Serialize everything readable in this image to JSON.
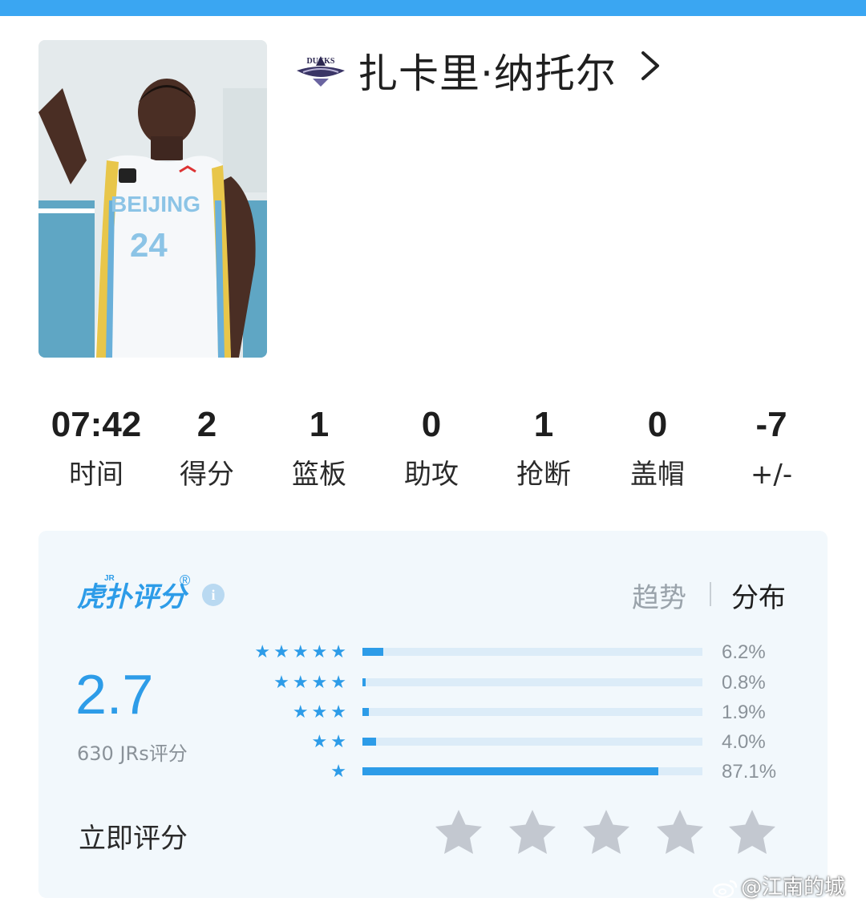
{
  "player": {
    "name": "扎卡里·纳托尔",
    "team_logo_text": "DUCKS",
    "photo_jersey_text": "BEIJING",
    "photo_jersey_number": "24"
  },
  "stats": [
    {
      "value": "07:42",
      "label": "时间"
    },
    {
      "value": "2",
      "label": "得分"
    },
    {
      "value": "1",
      "label": "篮板"
    },
    {
      "value": "0",
      "label": "助攻"
    },
    {
      "value": "1",
      "label": "抢断"
    },
    {
      "value": "0",
      "label": "盖帽"
    },
    {
      "value": "-7",
      "label": "+/-"
    }
  ],
  "rating": {
    "brand": "虎扑评分",
    "brand_mark": "®",
    "brand_superscript": "JR",
    "info_icon": "i",
    "tabs": {
      "trend": "趋势",
      "distribution": "分布"
    },
    "score": "2.7",
    "count_text": "630 JRs评分",
    "distribution": [
      {
        "stars": 5,
        "percent": 6.2,
        "label": "6.2%"
      },
      {
        "stars": 4,
        "percent": 0.8,
        "label": "0.8%"
      },
      {
        "stars": 3,
        "percent": 1.9,
        "label": "1.9%"
      },
      {
        "stars": 2,
        "percent": 4.0,
        "label": "4.0%"
      },
      {
        "stars": 1,
        "percent": 87.1,
        "label": "87.1%"
      }
    ],
    "rate_now_label": "立即评分"
  },
  "watermark": "@江南的城",
  "colors": {
    "accent": "#2d9ce8",
    "panel_bg": "#f2f8fc",
    "track": "#dcecf8",
    "star_empty": "#c3c8d0"
  }
}
